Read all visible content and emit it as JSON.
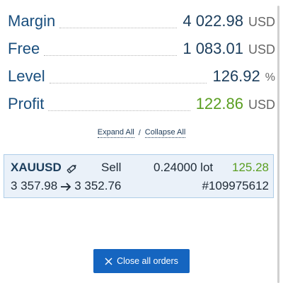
{
  "summary": {
    "margin": {
      "label": "Margin",
      "value": "4 022.98",
      "unit": "USD"
    },
    "free": {
      "label": "Free",
      "value": "1 083.01",
      "unit": "USD"
    },
    "level": {
      "label": "Level",
      "value": "126.92",
      "unit": "%"
    },
    "profit": {
      "label": "Profit",
      "value": "122.86",
      "unit": "USD"
    }
  },
  "controls": {
    "expand_all": "Expand All",
    "separator": "/",
    "collapse_all": "Collapse All"
  },
  "order": {
    "symbol": "XAUUSD",
    "side": "Sell",
    "volume": "0.24000 lot",
    "profit": "125.28",
    "open_price": "3 357.98",
    "current_price": "3 352.76",
    "ticket": "#109975612"
  },
  "actions": {
    "close_all": "Close all orders"
  },
  "colors": {
    "label_blue": "#1a4f7e",
    "profit_green": "#5a9e21",
    "button_blue": "#1565c0",
    "card_bg": "#eaf1f9",
    "card_border": "#aecde8"
  },
  "icons": {
    "edit": "pencil-edit-icon",
    "arrow": "arrow-right-icon",
    "close": "close-icon"
  }
}
